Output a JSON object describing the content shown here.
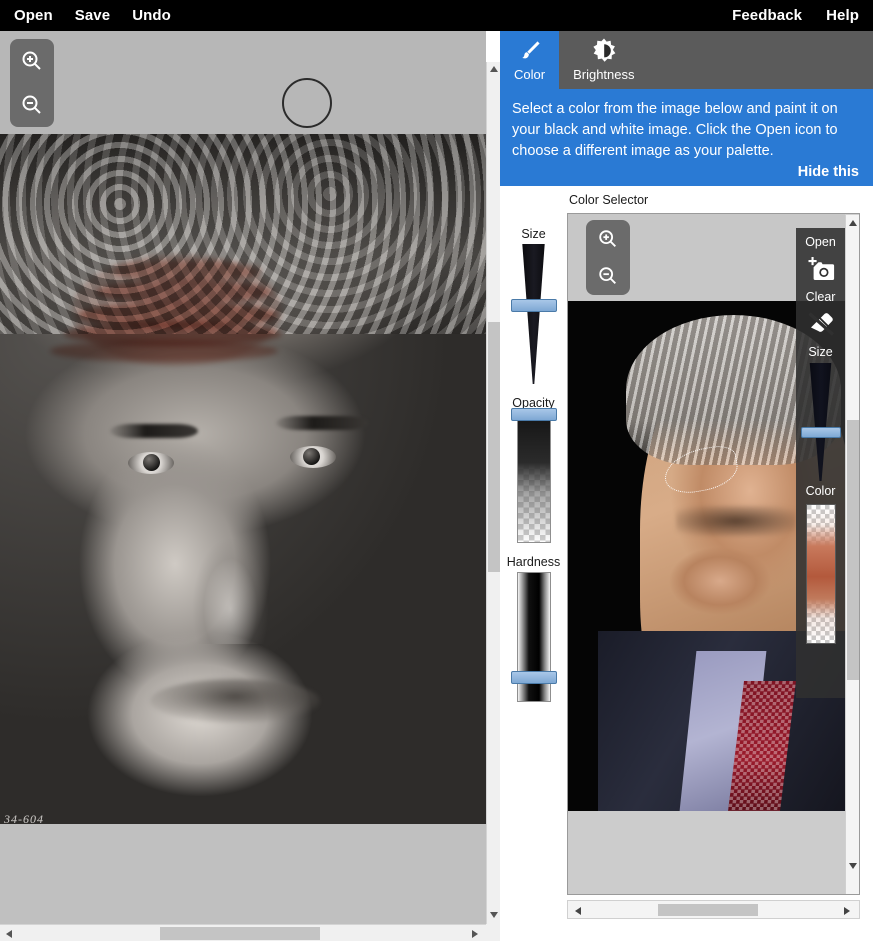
{
  "app": {
    "topbar": {
      "left_items": [
        {
          "label": "Open",
          "name": "menu-open"
        },
        {
          "label": "Save",
          "name": "menu-save"
        },
        {
          "label": "Undo",
          "name": "menu-undo"
        }
      ],
      "right_items": [
        {
          "label": "Feedback",
          "name": "menu-feedback"
        },
        {
          "label": "Help",
          "name": "menu-help"
        }
      ]
    }
  },
  "canvas": {
    "zoom_in_icon": "zoom-in-icon",
    "zoom_out_icon": "zoom-out-icon",
    "brush_cursor": "brush-cursor-circle",
    "photo_watermark": "34-604",
    "photo_description": "black-and-white portrait photograph with skin-tone paint strokes applied across the forehead"
  },
  "right_panel": {
    "tabs": [
      {
        "label": "Color",
        "icon": "paintbrush-icon",
        "active": true
      },
      {
        "label": "Brightness",
        "icon": "brightness-icon",
        "active": false
      }
    ],
    "instruction": {
      "text": "Select a color from the image below and paint it on your black and white image. Click the Open icon to choose a different image as your palette.",
      "hide_label": "Hide this",
      "background_color": "#2a7ad4"
    },
    "sliders": [
      {
        "label": "Size",
        "name": "size-slider",
        "thumb_percent": 42
      },
      {
        "label": "Opacity",
        "name": "opacity-slider",
        "thumb_percent": 2
      },
      {
        "label": "Hardness",
        "name": "hardness-slider",
        "thumb_percent": 80
      }
    ],
    "color_selector": {
      "label": "Color Selector",
      "zoom_in_icon": "zoom-in-icon",
      "zoom_out_icon": "zoom-out-icon",
      "palette_description": "color portrait photograph used as the color palette, with a dotted selection marquee over the eyebrow"
    },
    "tool_overlay": {
      "items": [
        {
          "label": "Open",
          "icon": "add-photo-icon",
          "name": "overlay-open-button"
        },
        {
          "label": "Clear",
          "icon": "eraser-icon",
          "name": "overlay-clear-button"
        },
        {
          "label": "Size",
          "icon": "size-slider-icon",
          "name": "overlay-size-slider",
          "thumb_percent": 56
        },
        {
          "label": "Color",
          "icon": "color-swatch-icon",
          "name": "overlay-color-swatch"
        }
      ]
    }
  },
  "colors": {
    "accent_blue": "#2a7ad4",
    "topbar_black": "#000000",
    "tabbar_gray": "#5b5b5b",
    "canvas_gray": "#b7b7b7",
    "overlay_dark": "#303030",
    "slider_thumb_blue": "#7ea8d4"
  }
}
